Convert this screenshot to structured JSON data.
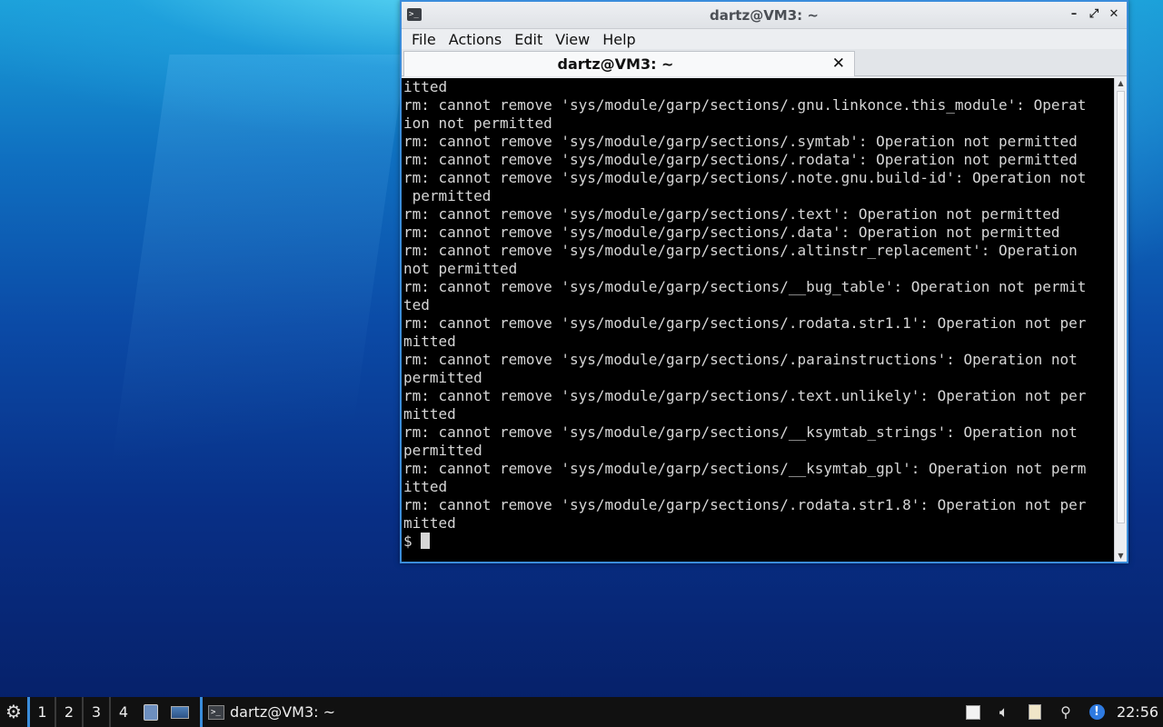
{
  "window": {
    "title": "dartz@VM3: ~",
    "app_icon": ">_",
    "controls": {
      "minimize": "–",
      "maximize": "⤢",
      "close": "✕"
    }
  },
  "menu": [
    "File",
    "Actions",
    "Edit",
    "View",
    "Help"
  ],
  "tab": {
    "label": "dartz@VM3: ~",
    "close": "✕"
  },
  "terminal": {
    "lines": [
      "itted",
      "rm: cannot remove 'sys/module/garp/sections/.gnu.linkonce.this_module': Operat",
      "ion not permitted",
      "rm: cannot remove 'sys/module/garp/sections/.symtab': Operation not permitted",
      "rm: cannot remove 'sys/module/garp/sections/.rodata': Operation not permitted",
      "rm: cannot remove 'sys/module/garp/sections/.note.gnu.build-id': Operation not",
      " permitted",
      "rm: cannot remove 'sys/module/garp/sections/.text': Operation not permitted",
      "rm: cannot remove 'sys/module/garp/sections/.data': Operation not permitted",
      "rm: cannot remove 'sys/module/garp/sections/.altinstr_replacement': Operation",
      "not permitted",
      "rm: cannot remove 'sys/module/garp/sections/__bug_table': Operation not permit",
      "ted",
      "rm: cannot remove 'sys/module/garp/sections/.rodata.str1.1': Operation not per",
      "mitted",
      "rm: cannot remove 'sys/module/garp/sections/.parainstructions': Operation not",
      "permitted",
      "rm: cannot remove 'sys/module/garp/sections/.text.unlikely': Operation not per",
      "mitted",
      "rm: cannot remove 'sys/module/garp/sections/__ksymtab_strings': Operation not",
      "permitted",
      "rm: cannot remove 'sys/module/garp/sections/__ksymtab_gpl': Operation not perm",
      "itted",
      "rm: cannot remove 'sys/module/garp/sections/.rodata.str1.8': Operation not per",
      "mitted"
    ],
    "prompt": "$ "
  },
  "taskbar": {
    "start_icon": "menu-icon",
    "desktops": [
      "1",
      "2",
      "3",
      "4"
    ],
    "task_label": "dartz@VM3: ~",
    "clock": "22:56"
  }
}
